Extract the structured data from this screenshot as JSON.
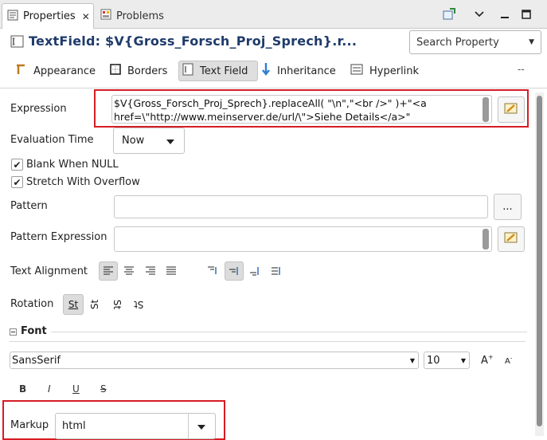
{
  "tabs": {
    "properties": "Properties",
    "problems": "Problems"
  },
  "title": "TextField: $V{Gross_Forsch_Proj_Sprech}.r...",
  "search": {
    "label": "Search Property"
  },
  "sections": [
    "Appearance",
    "Borders",
    "Text Field",
    "Inheritance",
    "Hyperlink"
  ],
  "sections_more": "--",
  "expression": {
    "label": "Expression",
    "value": "$V{Gross_Forsch_Proj_Sprech}.replaceAll( \"\\n\",\"<br />\" )+\"<a href=\\\"http://www.meinserver.de/url/\\\">Siehe Details</a>\""
  },
  "evaluation_time": {
    "label": "Evaluation Time",
    "value": "Now"
  },
  "checkboxes": {
    "blank_when_null": "Blank When NULL",
    "stretch_with_overflow": "Stretch With Overflow"
  },
  "pattern": {
    "label": "Pattern",
    "button": "..."
  },
  "pattern_expression": {
    "label": "Pattern Expression"
  },
  "text_alignment": {
    "label": "Text Alignment"
  },
  "rotation": {
    "label": "Rotation",
    "glyph": "St"
  },
  "font": {
    "section_label": "Font",
    "family": "SansSerif",
    "size": "10",
    "bold": "B",
    "italic": "I",
    "underline": "U",
    "strike": "S"
  },
  "markup": {
    "label": "Markup",
    "value": "html"
  },
  "colors": {
    "accent_title": "#1f3b6b",
    "highlight": "#d71c24"
  }
}
